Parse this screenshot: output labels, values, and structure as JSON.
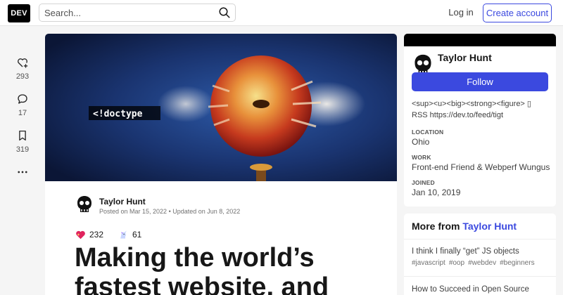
{
  "header": {
    "logo": "DEV",
    "search_placeholder": "Search...",
    "login": "Log in",
    "create_account": "Create account"
  },
  "reactions_bar": {
    "likes": "293",
    "comments": "17",
    "bookmarks": "319"
  },
  "article": {
    "cover_text": "<!doctype",
    "author": "Taylor Hunt",
    "meta": "Posted on Mar 15, 2022 • Updated on Jun 8, 2022",
    "hearts_count": "232",
    "unicorn_count": "61",
    "title_line1": "Making the world’s",
    "title_line2": "fastest website, and"
  },
  "profile": {
    "name": "Taylor Hunt",
    "follow": "Follow",
    "bio_line1": "<sup><u><big><strong><figure> ▯",
    "bio_line2": "RSS https://dev.to/feed/tigt",
    "location_label": "LOCATION",
    "location": "Ohio",
    "work_label": "WORK",
    "work": "Front-end Friend & Webperf Wungus",
    "joined_label": "JOINED",
    "joined": "Jan 10, 2019"
  },
  "more_from": {
    "prefix": "More from ",
    "author": "Taylor Hunt",
    "items": [
      {
        "title": "I think I finally “get” JS objects",
        "tags": [
          "#javascript",
          "#oop",
          "#webdev",
          "#beginners"
        ]
      },
      {
        "title": "How to Succeed in Open Source"
      }
    ]
  },
  "colors": {
    "accent": "#3b49df",
    "cover_blue": "#1e3a6e",
    "apple_red": "#c0271d"
  }
}
